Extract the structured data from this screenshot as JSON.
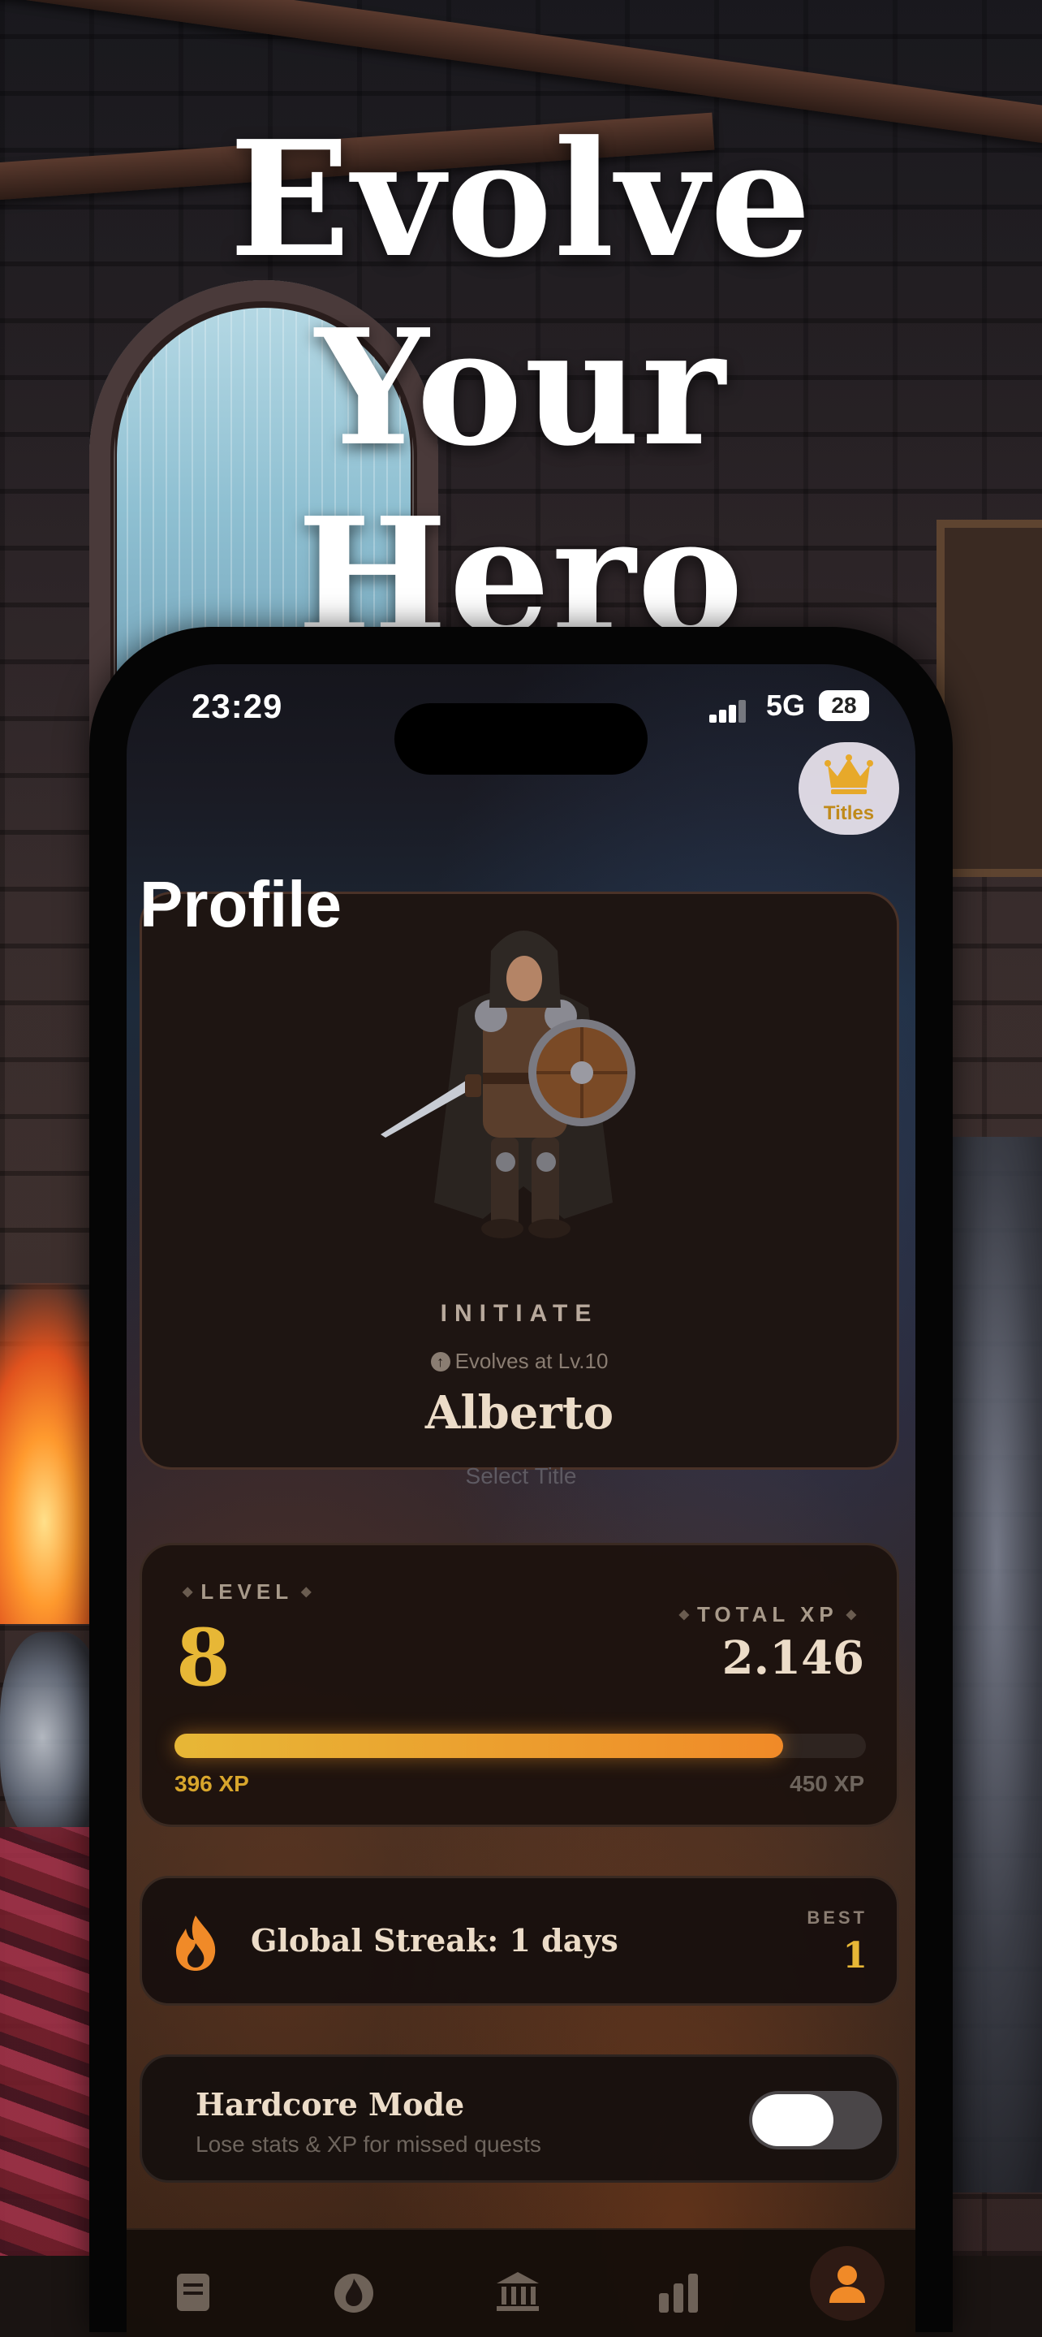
{
  "headline": {
    "line1": "Evolve Your",
    "line2": "Hero"
  },
  "status_bar": {
    "time": "23:29",
    "network": "5G",
    "battery": "28"
  },
  "header": {
    "title": "Profile",
    "titles_button": "Titles"
  },
  "hero": {
    "rank": "INITIATE",
    "evolve_hint": "Evolves at Lv.10",
    "name": "Alberto",
    "select_title": "Select Title"
  },
  "stats": {
    "level_label": "LEVEL",
    "level": "8",
    "total_xp_label": "TOTAL XP",
    "total_xp": "2.146",
    "xp_current": "396 XP",
    "xp_next": "450 XP",
    "progress": 0.88
  },
  "streak": {
    "label": "Global Streak: 1 days",
    "best_label": "BEST",
    "best_value": "1"
  },
  "hardcore": {
    "title": "Hardcore Mode",
    "subtitle": "Lose stats & XP for missed quests",
    "enabled": false
  },
  "tabs": [
    {
      "icon": "quests-icon"
    },
    {
      "icon": "streak-icon"
    },
    {
      "icon": "guild-icon"
    },
    {
      "icon": "stats-icon"
    },
    {
      "icon": "profile-icon",
      "active": true
    }
  ],
  "colors": {
    "accent_gold": "#e7b736",
    "accent_orange": "#f08a28",
    "card_bg": "#1e1512"
  }
}
